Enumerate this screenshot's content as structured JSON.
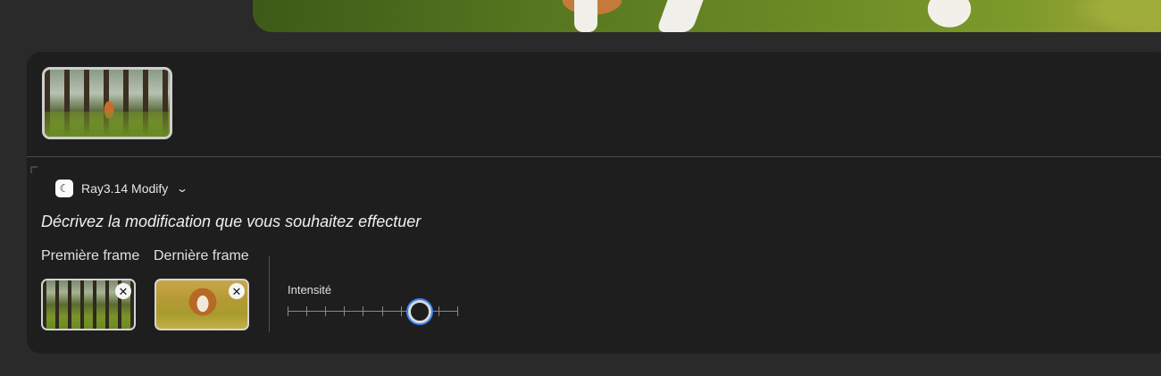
{
  "preview": {
    "image": "beagle-forest-video-preview"
  },
  "media": {
    "main_thumbnail": "beagle-in-forest-thumbnail"
  },
  "model": {
    "icon": "ray-logo-icon",
    "name": "Ray3.14 Modify",
    "dropdown_icon": "chevron-down-icon"
  },
  "prompt": {
    "placeholder": "Décrivez la modification que vous souhaitez effectuer"
  },
  "frames": {
    "first_label": "Première frame",
    "last_label": "Dernière frame",
    "first_image": "empty-forest-frame",
    "last_image": "beagle-closeup-frame",
    "remove_icon": "close-icon"
  },
  "intensity": {
    "label": "Intensité",
    "value": 7,
    "max": 9
  },
  "colors": {
    "accent": "#3b82f6",
    "panel": "#1e1e1e",
    "background": "#2a2a2a"
  }
}
